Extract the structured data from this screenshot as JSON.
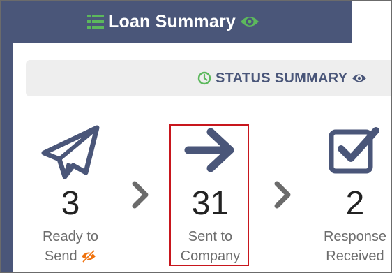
{
  "header": {
    "title": "Loan Summary",
    "list_icon": "list-icon",
    "eye_icon": "eye-icon"
  },
  "status": {
    "title": "STATUS SUMMARY",
    "clock_icon": "clock-icon",
    "eye_icon": "eye-icon"
  },
  "steps": [
    {
      "icon": "paper-plane-icon",
      "count": "3",
      "label_line1": "Ready to",
      "label_line2": "Send",
      "extra_icon": "eye-slash-icon"
    },
    {
      "icon": "arrow-right-icon",
      "count": "31",
      "label_line1": "Sent to",
      "label_line2": "Company"
    },
    {
      "icon": "checkbox-icon",
      "count": "2",
      "label_line1": "Response",
      "label_line2": "Received"
    }
  ],
  "colors": {
    "header_bg": "#4a5679",
    "accent_green": "#5cb85c",
    "status_text": "#4a5679",
    "highlight_border": "#c8161d",
    "warning_orange": "#f0730f"
  }
}
